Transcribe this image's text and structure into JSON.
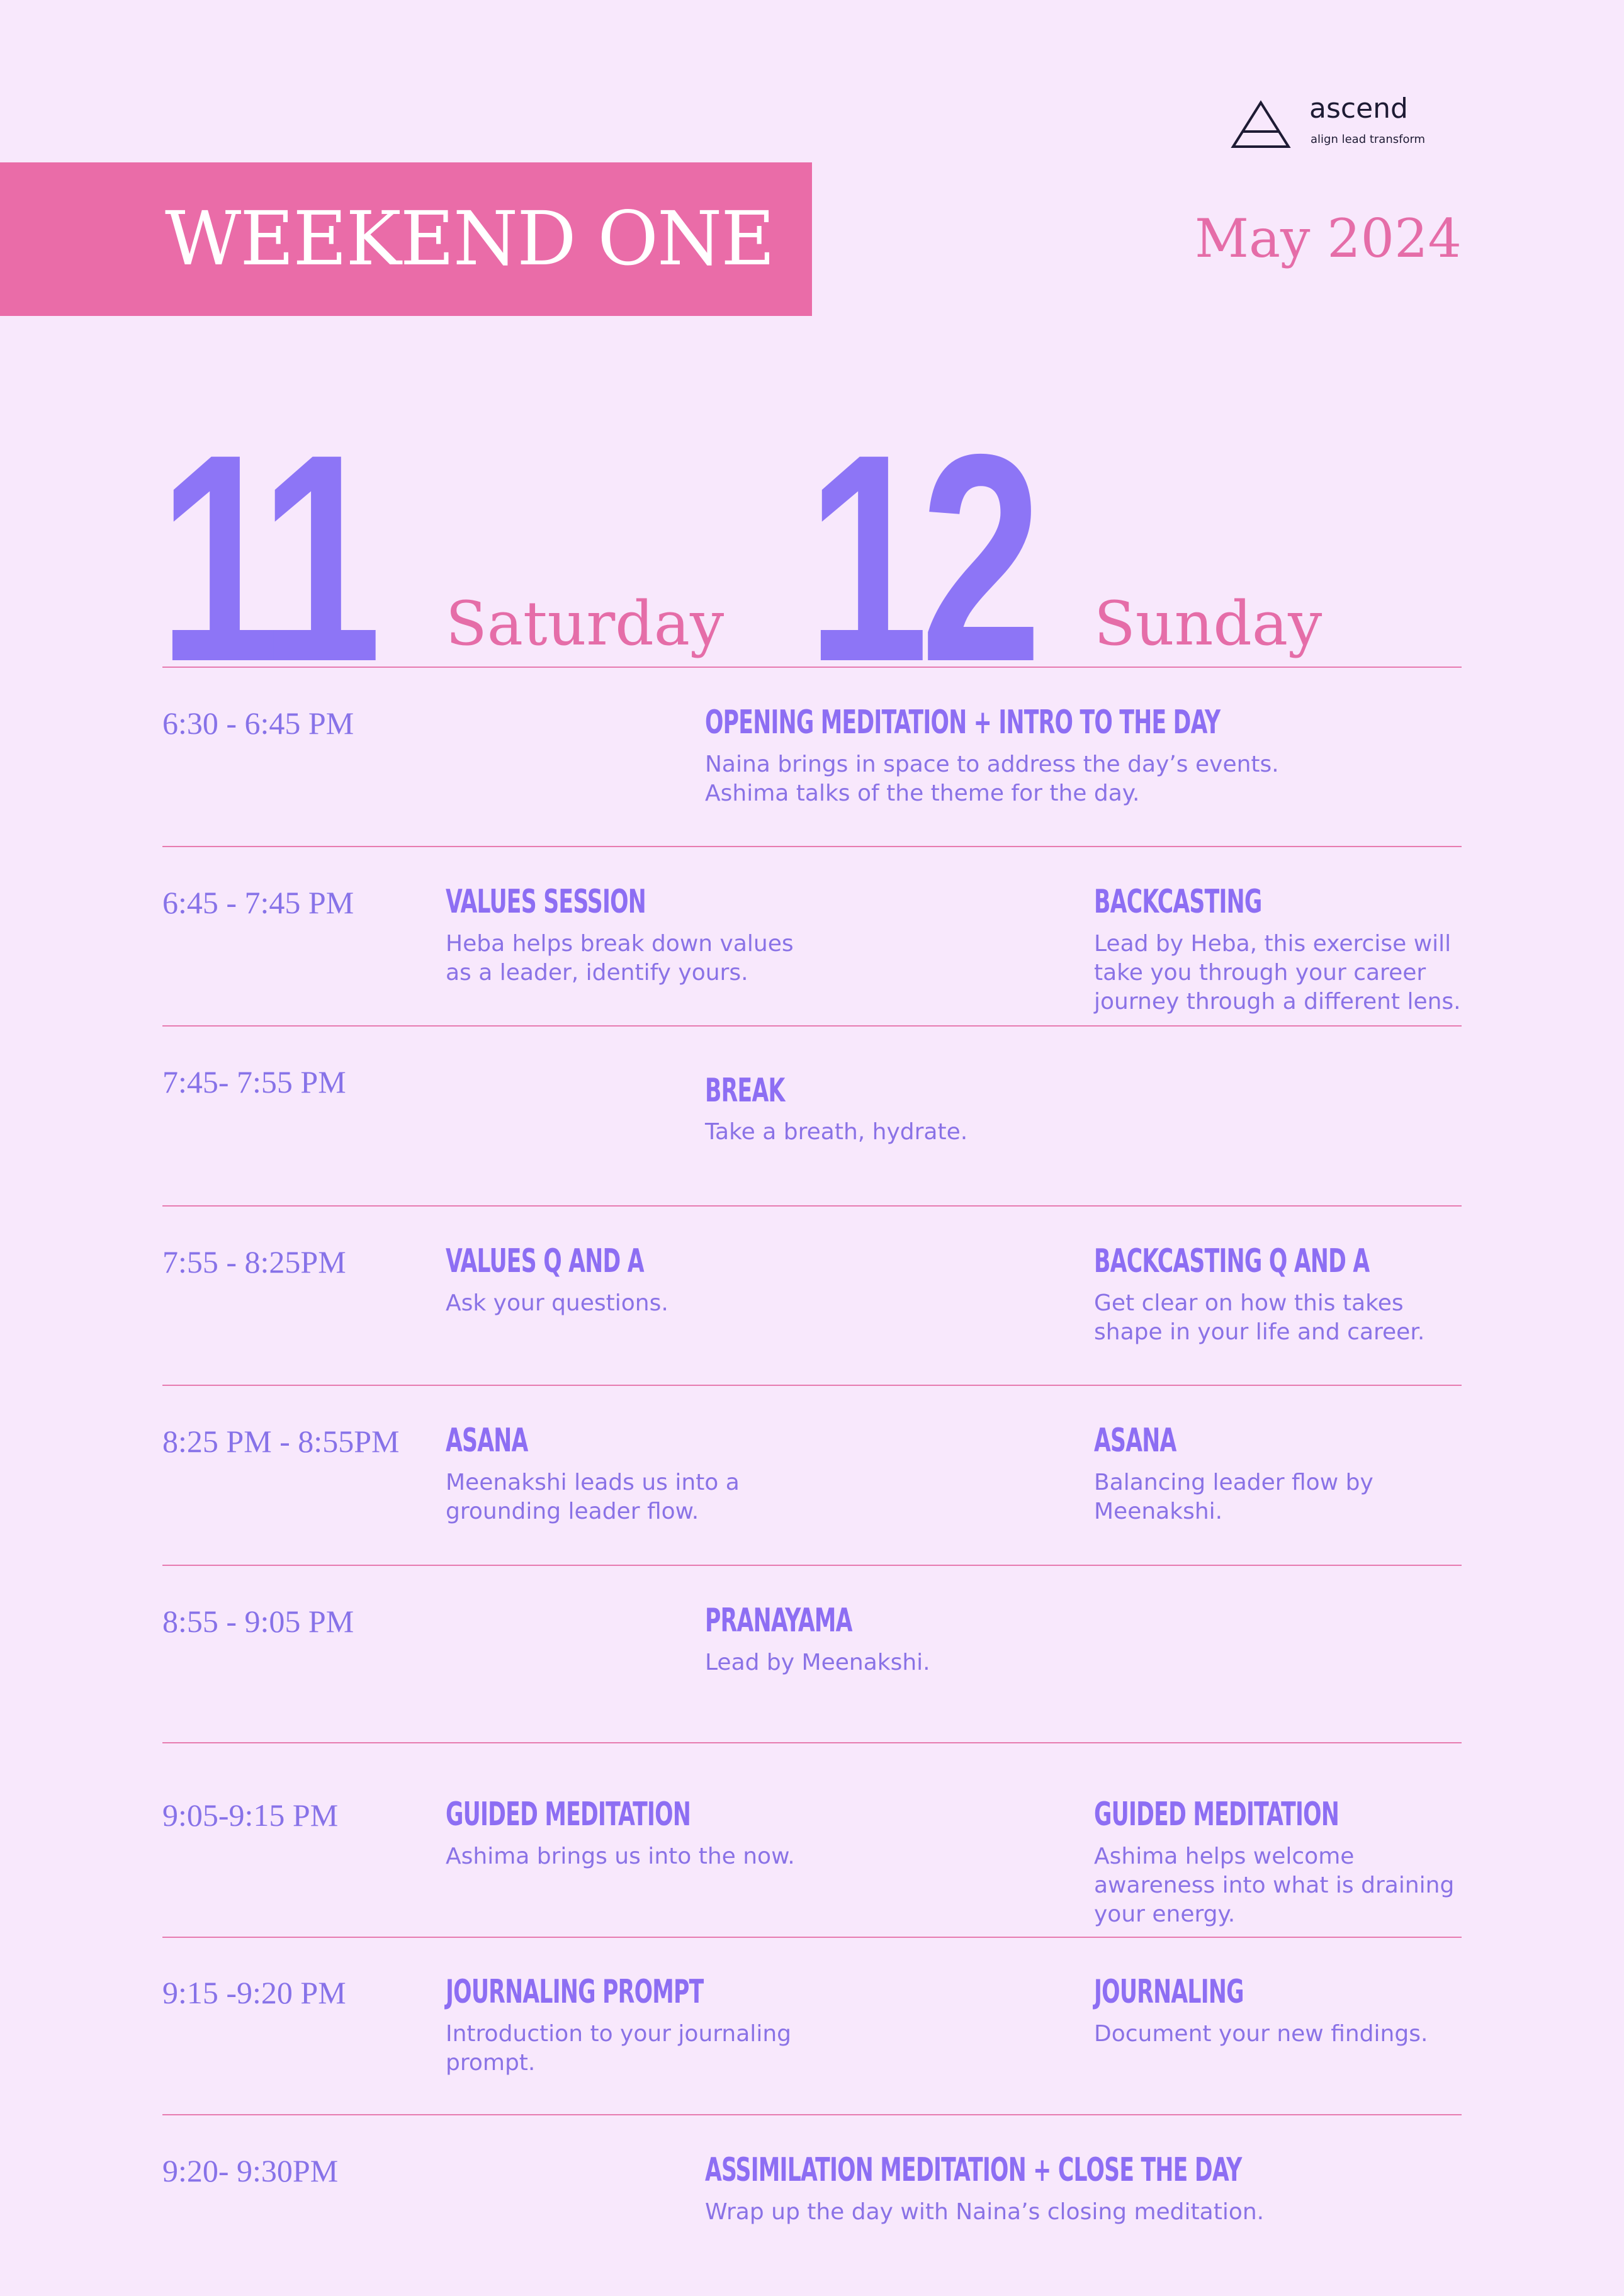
{
  "brand": {
    "name": "ascend",
    "tagline": "align lead transform"
  },
  "header": {
    "title": "WEEKEND ONE",
    "month": "May 2024"
  },
  "days": [
    {
      "number": "11",
      "name": "Saturday"
    },
    {
      "number": "12",
      "name": "Sunday"
    }
  ],
  "schedule": [
    {
      "time": "6:30 - 6:45 PM",
      "center": {
        "title": "OPENING MEDITATION + INTRO TO THE DAY",
        "desc": "Naina brings in space to address the day’s events.\nAshima talks of the theme for the day."
      }
    },
    {
      "time": "6:45 - 7:45 PM",
      "saturday": {
        "title": "VALUES SESSION",
        "desc": "Heba helps break down values\nas a leader, identify yours."
      },
      "sunday": {
        "title": "BACKCASTING",
        "desc": "Lead by Heba, this exercise will\ntake you through your career\njourney through a different lens."
      }
    },
    {
      "time": "7:45- 7:55 PM",
      "center": {
        "title": "BREAK",
        "desc": "Take a breath, hydrate."
      }
    },
    {
      "time": "7:55 - 8:25PM",
      "saturday": {
        "title": "VALUES Q AND A",
        "desc": "Ask your questions."
      },
      "sunday": {
        "title": "BACKCASTING Q AND A",
        "desc": "Get clear on how this takes\nshape in your life and career."
      }
    },
    {
      "time": "8:25 PM - 8:55PM",
      "saturday": {
        "title": "ASANA",
        "desc": "Meenakshi leads us into a\ngrounding leader flow."
      },
      "sunday": {
        "title": "ASANA",
        "desc": "Balancing leader flow by\nMeenakshi."
      }
    },
    {
      "time": "8:55 - 9:05 PM",
      "center": {
        "title": "PRANAYAMA",
        "desc": "Lead by Meenakshi."
      }
    },
    {
      "time": "9:05-9:15 PM",
      "saturday": {
        "title": "GUIDED MEDITATION",
        "desc": "Ashima brings us into the now."
      },
      "sunday": {
        "title": "GUIDED MEDITATION",
        "desc": "Ashima helps welcome\nawareness into what is draining\nyour energy."
      }
    },
    {
      "time": "9:15 -9:20 PM",
      "saturday": {
        "title": "JOURNALING PROMPT",
        "desc": "Introduction to your journaling\nprompt."
      },
      "sunday": {
        "title": "JOURNALING",
        "desc": "Document your new findings."
      }
    },
    {
      "time": "9:20- 9:30PM",
      "center": {
        "title": "ASSIMILATION MEDITATION + CLOSE THE DAY",
        "desc": "Wrap up the day with Naina’s closing meditation."
      }
    }
  ]
}
